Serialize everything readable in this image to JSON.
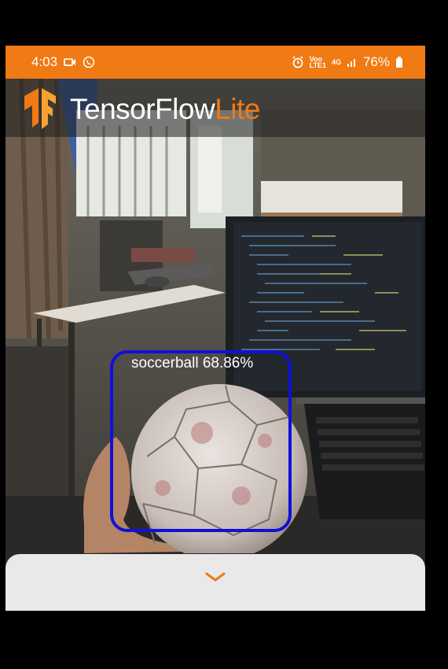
{
  "status_bar": {
    "time": "4:03",
    "network_line1": "Voo",
    "network_line2": "LTE1",
    "network_type": "4G",
    "battery": "76%",
    "icons": [
      "video-camera-icon",
      "whatsapp-icon",
      "alarm-icon",
      "signal-icon",
      "battery-icon"
    ]
  },
  "app_bar": {
    "brand_main": "TensorFlow",
    "brand_accent": "Lite",
    "accent_color": "#f07a13"
  },
  "detection": {
    "label": "soccerball 68.86%",
    "box_color": "#1010d8"
  },
  "bottom_sheet": {
    "icon": "chevron-down-icon"
  }
}
